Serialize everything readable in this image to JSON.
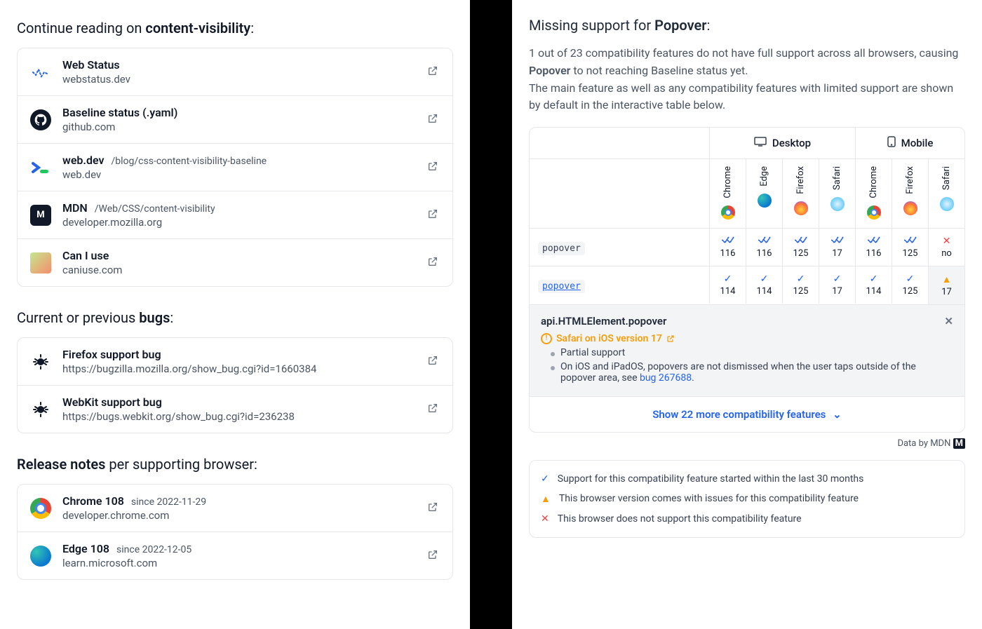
{
  "left": {
    "continue_heading_pre": "Continue reading on ",
    "continue_heading_bold": "content-visibility",
    "continue_heading_post": ":",
    "resources": [
      {
        "icon": "webstatus",
        "title": "Web Status",
        "path": "",
        "subtitle": "webstatus.dev"
      },
      {
        "icon": "github",
        "title": "Baseline status (.yaml)",
        "path": "",
        "subtitle": "github.com"
      },
      {
        "icon": "webdev",
        "title": "web.dev",
        "path": "/blog/css-content-visibility-baseline",
        "subtitle": "web.dev"
      },
      {
        "icon": "mdn",
        "title": "MDN",
        "path": "/Web/CSS/content-visibility",
        "subtitle": "developer.mozilla.org"
      },
      {
        "icon": "caniuse",
        "title": "Can I use",
        "path": "",
        "subtitle": "caniuse.com"
      }
    ],
    "bugs_heading_pre": "Current or previous ",
    "bugs_heading_bold": "bugs",
    "bugs_heading_post": ":",
    "bugs": [
      {
        "title": "Firefox support bug",
        "url": "https://bugzilla.mozilla.org/show_bug.cgi?id=1660384"
      },
      {
        "title": "WebKit support bug",
        "url": "https://bugs.webkit.org/show_bug.cgi?id=236238"
      }
    ],
    "release_heading_bold": "Release notes",
    "release_heading_post": " per supporting browser:",
    "releases": [
      {
        "icon": "chrome",
        "title": "Chrome 108",
        "since": "since 2022-11-29",
        "subtitle": "developer.chrome.com"
      },
      {
        "icon": "edge",
        "title": "Edge 108",
        "since": "since 2022-12-05",
        "subtitle": "learn.microsoft.com"
      }
    ]
  },
  "right": {
    "heading_pre": "Missing support for ",
    "heading_bold": "Popover",
    "heading_post": ":",
    "desc1_pre": "1 out of 23 compatibility features do not have full support across all browsers, causing ",
    "desc1_bold": "Popover",
    "desc1_post": " to not reaching Baseline status yet.",
    "desc2": "The main feature as well as any compatibility features with limited support are shown by default in the interactive table below.",
    "groups": {
      "desktop": "Desktop",
      "mobile": "Mobile"
    },
    "browsers": [
      {
        "name": "Chrome",
        "icon": "chrome",
        "group": "desktop"
      },
      {
        "name": "Edge",
        "icon": "edge",
        "group": "desktop"
      },
      {
        "name": "Firefox",
        "icon": "firefox",
        "group": "desktop"
      },
      {
        "name": "Safari",
        "icon": "safari",
        "group": "desktop"
      },
      {
        "name": "Chrome",
        "icon": "chrome",
        "group": "mobile"
      },
      {
        "name": "Firefox",
        "icon": "firefox",
        "group": "mobile"
      },
      {
        "name": "Safari",
        "icon": "safari",
        "group": "mobile"
      }
    ],
    "rows": [
      {
        "label": "popover",
        "link": false,
        "cells": [
          {
            "s": "new",
            "v": "116"
          },
          {
            "s": "new",
            "v": "116"
          },
          {
            "s": "new",
            "v": "125"
          },
          {
            "s": "new",
            "v": "17"
          },
          {
            "s": "new",
            "v": "116"
          },
          {
            "s": "new",
            "v": "125"
          },
          {
            "s": "no",
            "v": "no"
          }
        ]
      },
      {
        "label": "popover",
        "link": true,
        "cells": [
          {
            "s": "ok",
            "v": "114"
          },
          {
            "s": "ok",
            "v": "114"
          },
          {
            "s": "ok",
            "v": "125"
          },
          {
            "s": "ok",
            "v": "17"
          },
          {
            "s": "ok",
            "v": "114"
          },
          {
            "s": "ok",
            "v": "125"
          },
          {
            "s": "warn",
            "v": "17"
          }
        ]
      }
    ],
    "detail": {
      "api": "api.HTMLElement.popover",
      "safari_line": "Safari on iOS version 17",
      "partial": "Partial support",
      "note_pre": "On iOS and iPadOS, popovers are not dismissed when the user taps outside of the popover area, see ",
      "note_link": "bug 267688",
      "note_post": "."
    },
    "show_more": "Show 22 more compatibility features",
    "data_by": "Data by MDN",
    "legend": [
      {
        "icon": "check",
        "text": "Support for this compatibility feature started within the last 30 months"
      },
      {
        "icon": "warn",
        "text": "This browser version comes with issues for this compatibility feature"
      },
      {
        "icon": "cross",
        "text": "This browser does not support this compatibility feature"
      }
    ]
  }
}
